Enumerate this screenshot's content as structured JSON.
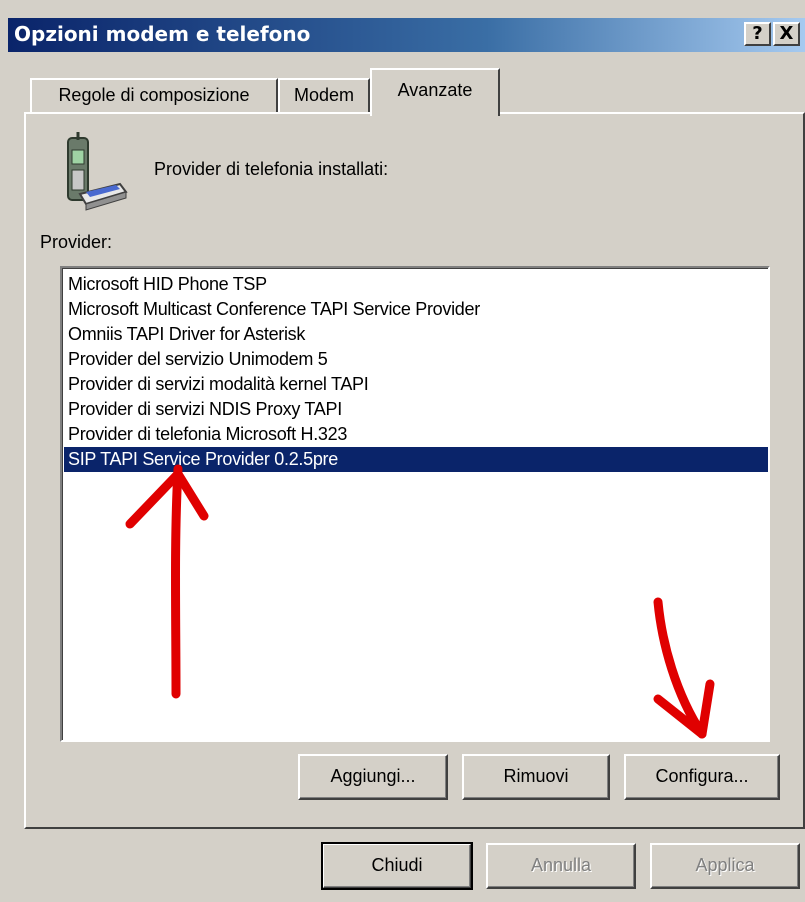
{
  "window": {
    "title": "Opzioni modem e telefono",
    "help_button": "?",
    "close_button": "X"
  },
  "tabs": [
    {
      "label": "Regole di composizione",
      "active": false
    },
    {
      "label": "Modem",
      "active": false
    },
    {
      "label": "Avanzate",
      "active": true
    }
  ],
  "panel": {
    "icon": "phone-modem-icon",
    "heading": "Provider di telefonia installati:",
    "list_label": "Provider:",
    "providers": [
      "Microsoft HID Phone TSP",
      "Microsoft Multicast Conference TAPI Service Provider",
      "Omniis TAPI Driver for Asterisk",
      "Provider del servizio Unimodem 5",
      "Provider di servizi modalità kernel TAPI",
      "Provider di servizi NDIS Proxy TAPI",
      "Provider di telefonia Microsoft H.323",
      "SIP TAPI Service Provider 0.2.5pre"
    ],
    "selected_index": 7,
    "buttons": {
      "add": "Aggiungi...",
      "remove": "Rimuovi",
      "configure": "Configura..."
    }
  },
  "footer": {
    "close": "Chiudi",
    "cancel": "Annulla",
    "apply": "Applica"
  },
  "colors": {
    "selection": "#0a246a",
    "annotation": "#e00000",
    "face": "#d4d0c8"
  }
}
